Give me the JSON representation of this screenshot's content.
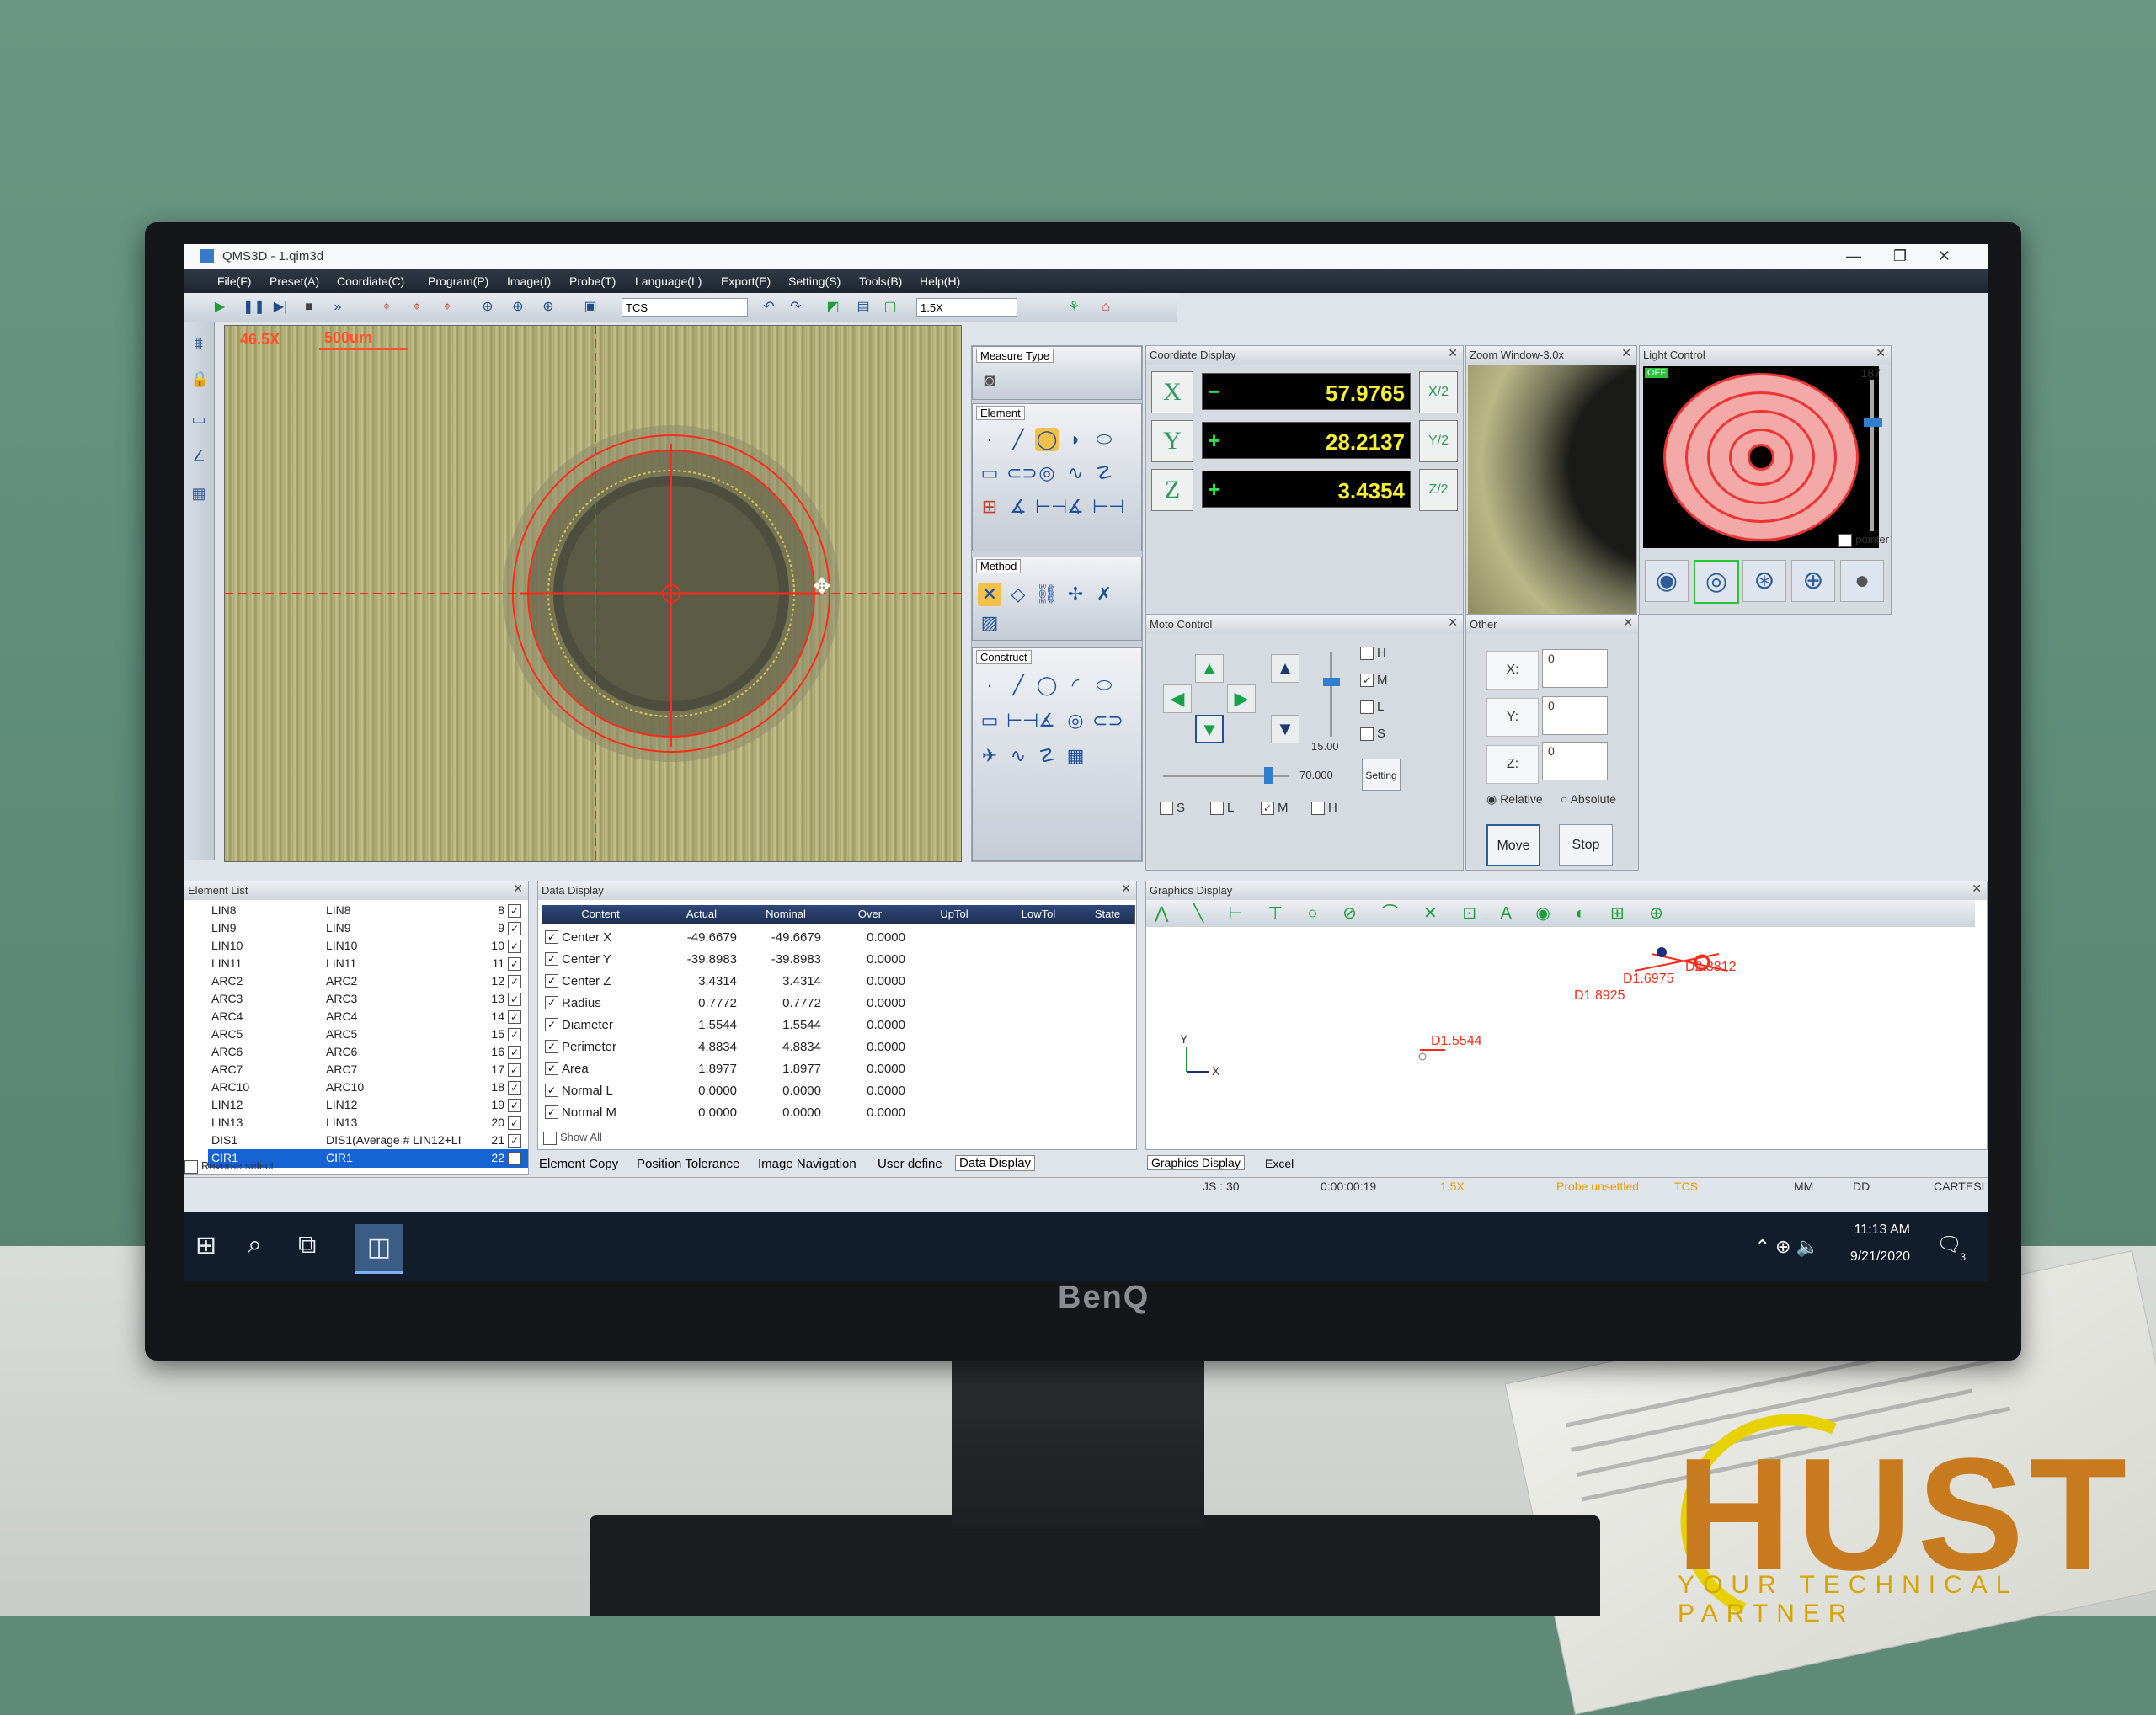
{
  "window": {
    "title": "QMS3D - 1.qim3d",
    "minimize": "—",
    "restore": "❐",
    "close": "✕"
  },
  "menu": [
    "File(F)",
    "Preset(A)",
    "Coordiate(C)",
    "Program(P)",
    "Image(I)",
    "Probe(T)",
    "Language(L)",
    "Export(E)",
    "Setting(S)",
    "Tools(B)",
    "Help(H)"
  ],
  "toolbar": {
    "coord_system": "TCS",
    "zoom": "1.5X"
  },
  "camera": {
    "magnification": "46.5X",
    "scale_label": "500um"
  },
  "measure_panel": {
    "measure_type": "Measure Type",
    "element": "Element",
    "method": "Method",
    "construct": "Construct"
  },
  "coordinate_display": {
    "title": "Coordiate Display",
    "rows": [
      {
        "axis": "X",
        "sign": "−",
        "value": "57.9765",
        "half": "X/2"
      },
      {
        "axis": "Y",
        "sign": "+",
        "value": "28.2137",
        "half": "Y/2"
      },
      {
        "axis": "Z",
        "sign": "+",
        "value": "3.4354",
        "half": "Z/2"
      }
    ]
  },
  "zoom_window": {
    "title": "Zoom Window-3.0x"
  },
  "light_control": {
    "title": "Light Control",
    "status": "OFF",
    "level": "187",
    "pointer_label": "pointer",
    "level_fraction": 0.73
  },
  "moto_control": {
    "title": "Moto Control",
    "speed_value": "15.00",
    "slider_value": "70.000",
    "setting_label": "Setting",
    "right_checks": [
      {
        "label": "H",
        "checked": false
      },
      {
        "label": "M",
        "checked": true
      },
      {
        "label": "L",
        "checked": false
      },
      {
        "label": "S",
        "checked": false
      }
    ],
    "bottom_checks": [
      {
        "label": "S",
        "checked": false
      },
      {
        "label": "L",
        "checked": false
      },
      {
        "label": "M",
        "checked": true
      },
      {
        "label": "H",
        "checked": false
      }
    ]
  },
  "other": {
    "title": "Other",
    "fields": [
      {
        "label": "X:",
        "value": "0"
      },
      {
        "label": "Y:",
        "value": "0"
      },
      {
        "label": "Z:",
        "value": "0"
      }
    ],
    "relative_label": "Relative",
    "absolute_label": "Absolute",
    "move_label": "Move",
    "stop_label": "Stop"
  },
  "element_list": {
    "title": "Element List",
    "rows": [
      {
        "name": "LIN8",
        "label": "LIN8",
        "num": "8"
      },
      {
        "name": "LIN9",
        "label": "LIN9",
        "num": "9"
      },
      {
        "name": "LIN10",
        "label": "LIN10",
        "num": "10"
      },
      {
        "name": "LIN11",
        "label": "LIN11",
        "num": "11"
      },
      {
        "name": "ARC2",
        "label": "ARC2",
        "num": "12"
      },
      {
        "name": "ARC3",
        "label": "ARC3",
        "num": "13"
      },
      {
        "name": "ARC4",
        "label": "ARC4",
        "num": "14"
      },
      {
        "name": "ARC5",
        "label": "ARC5",
        "num": "15"
      },
      {
        "name": "ARC6",
        "label": "ARC6",
        "num": "16"
      },
      {
        "name": "ARC7",
        "label": "ARC7",
        "num": "17"
      },
      {
        "name": "ARC10",
        "label": "ARC10",
        "num": "18"
      },
      {
        "name": "LIN12",
        "label": "LIN12",
        "num": "19"
      },
      {
        "name": "LIN13",
        "label": "LIN13",
        "num": "20"
      },
      {
        "name": "DIS1",
        "label": "DIS1(Average # LIN12+LI",
        "num": "21"
      },
      {
        "name": "CIR1",
        "label": "CIR1",
        "num": "22"
      }
    ],
    "reverse_select": "Reverse select"
  },
  "data_display": {
    "title": "Data Display",
    "columns": [
      "Content",
      "Actual",
      "Nominal",
      "Over",
      "UpTol",
      "LowTol",
      "State"
    ],
    "rows": [
      {
        "content": "Center X",
        "actual": "-49.6679",
        "nominal": "-49.6679",
        "over": "0.0000"
      },
      {
        "content": "Center Y",
        "actual": "-39.8983",
        "nominal": "-39.8983",
        "over": "0.0000"
      },
      {
        "content": "Center Z",
        "actual": "3.4314",
        "nominal": "3.4314",
        "over": "0.0000"
      },
      {
        "content": "Radius",
        "actual": "0.7772",
        "nominal": "0.7772",
        "over": "0.0000"
      },
      {
        "content": "Diameter",
        "actual": "1.5544",
        "nominal": "1.5544",
        "over": "0.0000"
      },
      {
        "content": "Perimeter",
        "actual": "4.8834",
        "nominal": "4.8834",
        "over": "0.0000"
      },
      {
        "content": "Area",
        "actual": "1.8977",
        "nominal": "1.8977",
        "over": "0.0000"
      },
      {
        "content": "Normal L",
        "actual": "0.0000",
        "nominal": "0.0000",
        "over": "0.0000"
      },
      {
        "content": "Normal M",
        "actual": "0.0000",
        "nominal": "0.0000",
        "over": "0.0000"
      }
    ],
    "show_all": "Show All"
  },
  "bottom_tabs": [
    "Element Copy",
    "Position Tolerance",
    "Image Navigation",
    "User define",
    "Data Display"
  ],
  "graphics_display": {
    "title": "Graphics Display",
    "labels": [
      "D2.3812",
      "D1.6975",
      "D1.8925",
      "D1.5544"
    ],
    "axis_y": "Y",
    "axis_x": "X",
    "tabs": [
      "Graphics Display",
      "Excel"
    ]
  },
  "status": {
    "js": "JS : 30",
    "time": "0:00:00:19",
    "zoom": "1.5X",
    "probe": "Probe unsettled",
    "cs": "TCS",
    "unit": "MM",
    "angle": "DD",
    "mode": "CARTESI"
  },
  "taskbar": {
    "clock": "11:13 AM",
    "date": "9/21/2020",
    "notif": "3"
  },
  "monitor": {
    "brand": "BenQ"
  },
  "overlay_logo": {
    "word": "HUST",
    "tagline": "YOUR TECHNICAL PARTNER"
  },
  "colors": {
    "accent": "#1663d6",
    "measure": "#ff2a1a",
    "coord_text": "#f4ef32",
    "status_orange": "#e59a00"
  }
}
